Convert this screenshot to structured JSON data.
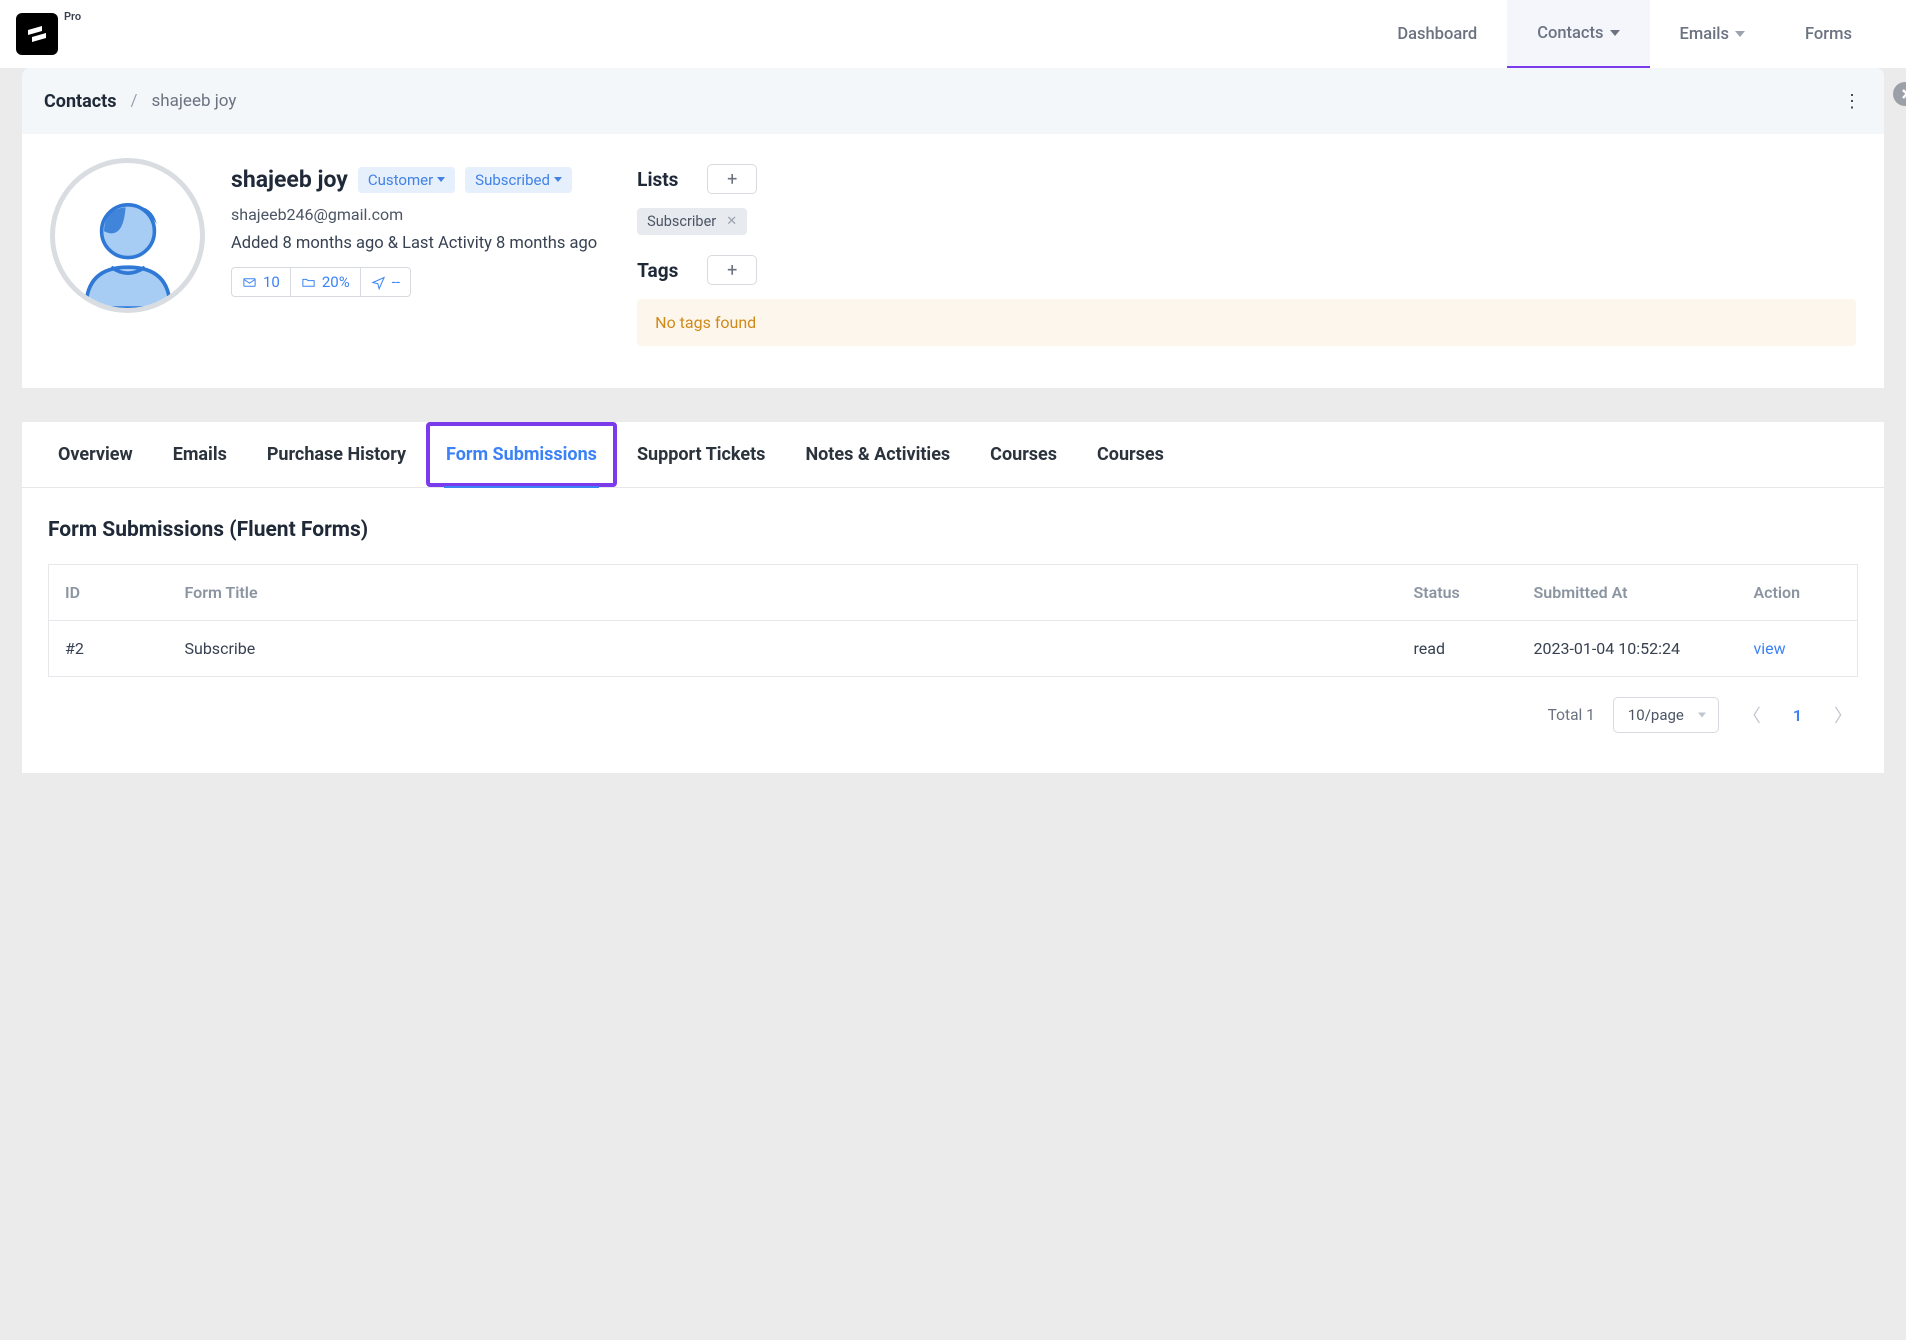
{
  "brand": {
    "pro_label": "Pro"
  },
  "nav": {
    "items": [
      {
        "label": "Dashboard",
        "has_dropdown": false,
        "active": false
      },
      {
        "label": "Contacts",
        "has_dropdown": true,
        "active": true
      },
      {
        "label": "Emails",
        "has_dropdown": true,
        "active": false
      },
      {
        "label": "Forms",
        "has_dropdown": false,
        "active": false
      }
    ]
  },
  "breadcrumb": {
    "root": "Contacts",
    "leaf": "shajeeb joy"
  },
  "contact": {
    "name": "shajeeb joy",
    "role_pill": "Customer",
    "status_pill": "Subscribed",
    "email": "shajeeb246@gmail.com",
    "meta_line": "Added 8 months ago & Last Activity 8 months ago",
    "stats": {
      "emails": "10",
      "open_rate": "20%",
      "sends": "--"
    }
  },
  "lists": {
    "title": "Lists",
    "items": [
      {
        "label": "Subscriber"
      }
    ]
  },
  "tags": {
    "title": "Tags",
    "empty_message": "No tags found"
  },
  "tabs": [
    {
      "label": "Overview",
      "active": false
    },
    {
      "label": "Emails",
      "active": false
    },
    {
      "label": "Purchase History",
      "active": false
    },
    {
      "label": "Form Submissions",
      "active": true,
      "highlighted": true
    },
    {
      "label": "Support Tickets",
      "active": false
    },
    {
      "label": "Notes & Activities",
      "active": false
    },
    {
      "label": "Courses",
      "active": false
    },
    {
      "label": "Courses",
      "active": false
    }
  ],
  "panel": {
    "title": "Form Submissions (Fluent Forms)",
    "columns": {
      "id": "ID",
      "form_title": "Form Title",
      "status": "Status",
      "submitted_at": "Submitted At",
      "action": "Action"
    },
    "rows": [
      {
        "id": "#2",
        "form_title": "Subscribe",
        "status": "read",
        "submitted_at": "2023-01-04 10:52:24",
        "action": "view"
      }
    ]
  },
  "pagination": {
    "total_label": "Total 1",
    "page_size_label": "10/page",
    "current_page": "1"
  }
}
